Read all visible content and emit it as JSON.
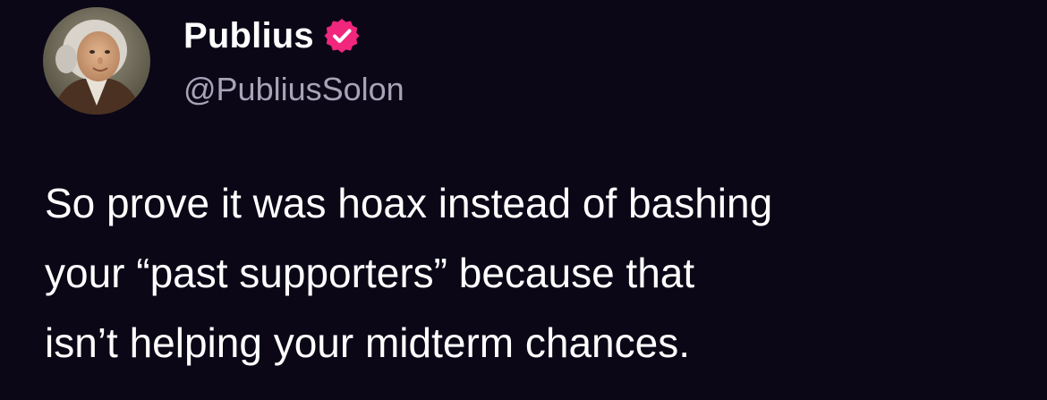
{
  "author": {
    "display_name": "Publius",
    "handle": "@PubliusSolon",
    "verified_icon": "verified-badge-icon",
    "badge_color": "#f0277d"
  },
  "tweet": {
    "text_lines": [
      "So prove it was hoax instead of bashing",
      "your “past supporters” because that",
      "isn’t helping your midterm chances."
    ]
  },
  "theme": {
    "background": "#0b0717",
    "text_color": "#ffffff",
    "handle_color": "#a8a3b7"
  }
}
